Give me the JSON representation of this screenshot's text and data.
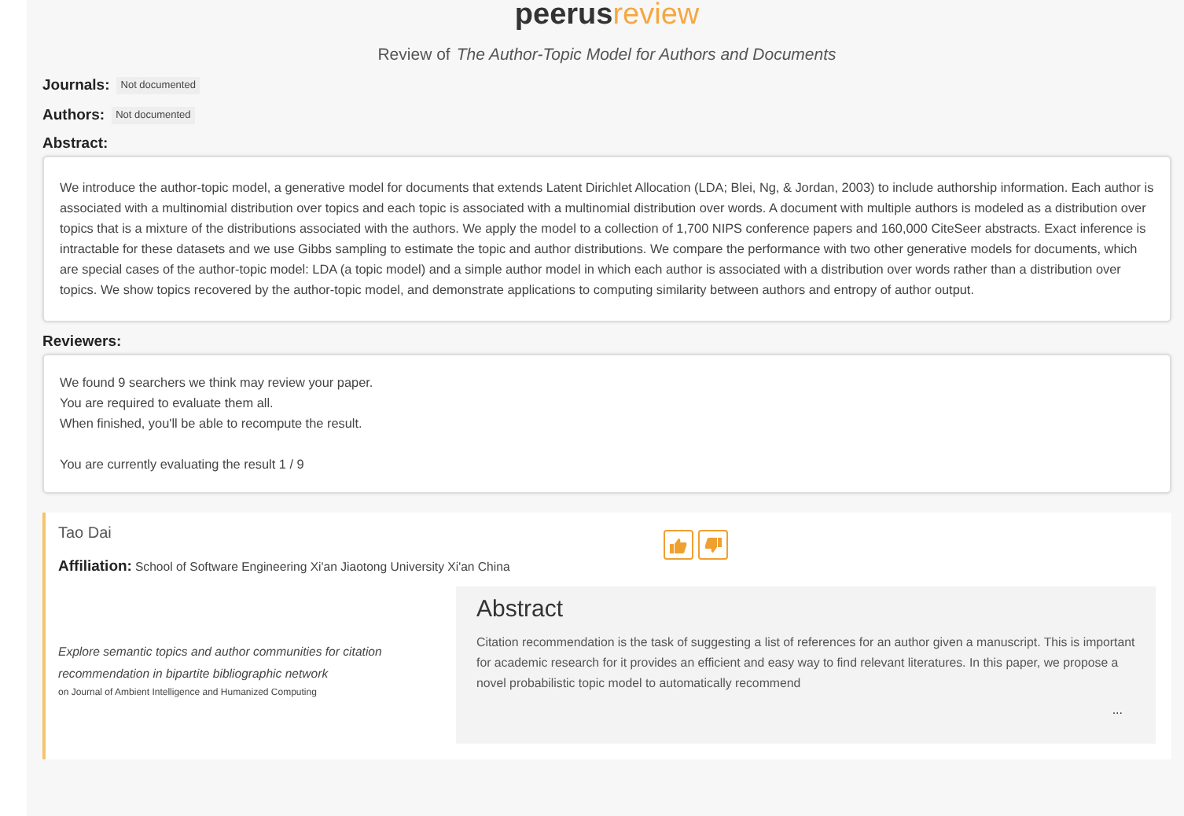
{
  "logo": {
    "part_1": "peerus",
    "part_2": "review"
  },
  "heading": {
    "prefix": "Review of",
    "title": "The Author-Topic Model for Authors and Documents"
  },
  "meta": [
    {
      "label": "Journals:",
      "value": "Not documented"
    },
    {
      "label": "Authors:",
      "value": "Not documented"
    }
  ],
  "abstract": {
    "label": "Abstract:",
    "text": "We introduce the author-topic model, a generative model for documents that extends Latent Dirichlet Allocation (LDA; Blei, Ng, & Jordan, 2003) to include authorship information. Each author is associated with a multinomial distribution over topics and each topic is associated with a multinomial distribution over words. A document with multiple authors is modeled as a distribution over topics that is a mixture of the distributions associated with the authors. We apply the model to a collection of 1,700 NIPS conference papers and 160,000 CiteSeer abstracts. Exact inference is intractable for these datasets and we use Gibbs sampling to estimate the topic and author distributions. We compare the performance with two other generative models for documents, which are special cases of the author-topic model: LDA (a topic model) and a simple author model in which each author is associated with a distribution over words rather than a distribution over topics. We show topics recovered by the author-topic model, and demonstrate applications to computing similarity between authors and entropy of author output."
  },
  "reviewers": {
    "label": "Reviewers:",
    "lines": [
      "We found 9 searchers we think may review your paper.",
      "You are required to evaluate them all.",
      "When finished, you'll be able to recompute the result."
    ],
    "status": "You are currently evaluating the result 1 / 9"
  },
  "candidate": {
    "name": "Tao Dai",
    "affiliation_label": "Affiliation:",
    "affiliation": "School of Software Engineering Xi'an Jiaotong University Xi'an China",
    "paper_title": "Explore semantic topics and author communities for citation recommendation in bipartite bibliographic network",
    "venue": "on Journal of Ambient Intelligence and Humanized Computing",
    "abstract_heading": "Abstract",
    "abstract_text": "Citation recommendation is the task of suggesting a list of references for an author given a manuscript. This is important for academic research for it provides an efficient and easy way to find relevant literatures. In this paper, we propose a novel probabilistic topic model to automatically recommend",
    "more": "..."
  }
}
